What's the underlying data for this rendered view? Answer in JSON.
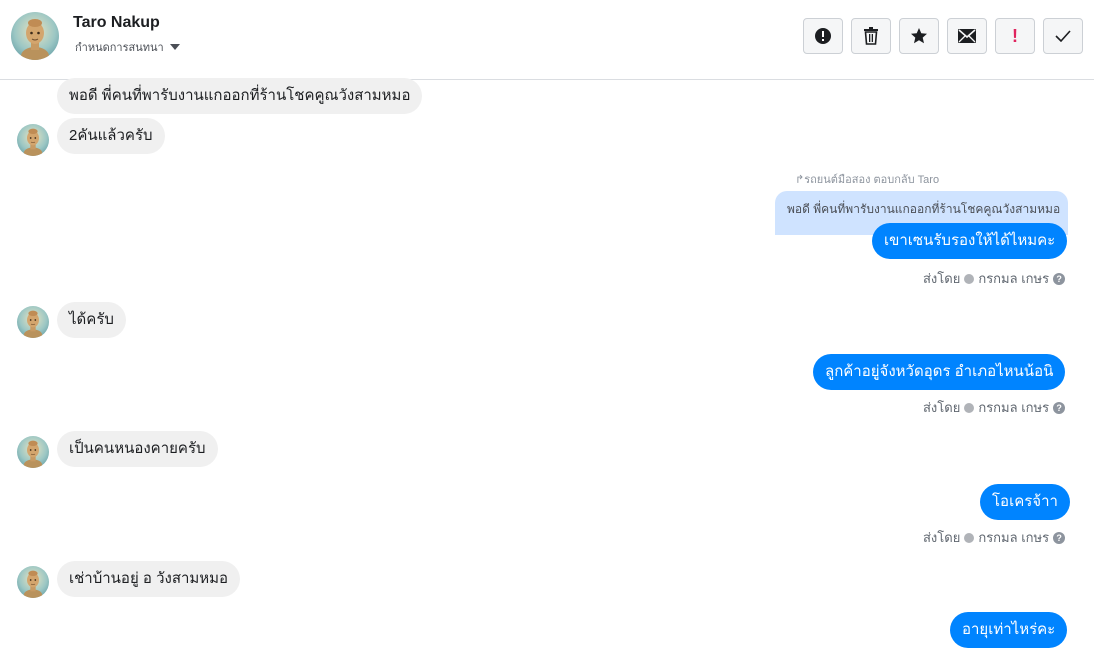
{
  "header": {
    "contact_name": "Taro Nakup",
    "assign_label": "กำหนดการสนทนา"
  },
  "toolbar": [
    {
      "name": "spam-button",
      "icon": "alert-circle-icon"
    },
    {
      "name": "delete-button",
      "icon": "trash-icon"
    },
    {
      "name": "star-button",
      "icon": "star-icon"
    },
    {
      "name": "mark-unread-button",
      "icon": "envelope-icon"
    },
    {
      "name": "important-button",
      "icon": "exclamation-icon",
      "color": "#e0245e"
    },
    {
      "name": "mark-done-button",
      "icon": "check-icon"
    }
  ],
  "messages": {
    "m1": "พอดี พี่คนที่พารับงานแกออกที่ร้านโชคคูณวังสามหมอ",
    "m2": "2คันแล้วครับ",
    "reply_note": "รถยนต์มือสอง ตอบกลับ Taro",
    "quote": "พอดี พี่คนที่พารับงานแกออกที่ร้านโชคคูณวังสามหมอ",
    "m3": "เขาเซนรับรองให้ได้ไหมคะ",
    "m4": "ได้ครับ",
    "m5": "ลูกค้าอยู่จังหวัดอุดร อำเภอไหนน้อนิ",
    "m6": "เป็นคนหนองคายครับ",
    "m7": "โอเครจ้าา",
    "m8": "เช่าบ้านอยู่ อ วังสามหมอ",
    "m9": "อายุเท่าไหร่คะ"
  },
  "sent_by": {
    "prefix": "ส่งโดย",
    "name": "กรกมล เกษร",
    "help": "?"
  },
  "colors": {
    "outgoing": "#0084ff",
    "incoming": "#f0f0f0",
    "quote_bg": "#cfe3ff"
  }
}
